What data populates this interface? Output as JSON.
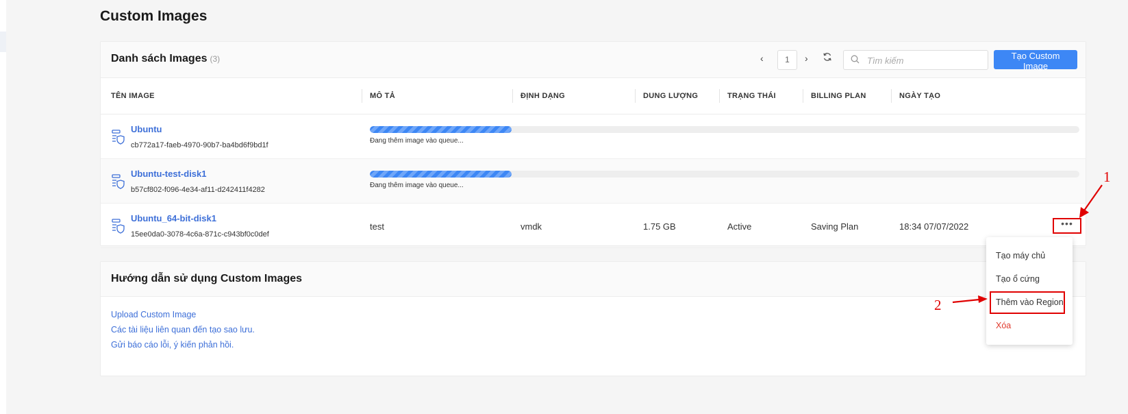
{
  "page_title": "Custom Images",
  "list_card": {
    "title": "Danh sách Images",
    "count": "(3)",
    "pagination": {
      "page": "1",
      "prev_icon": "chevron-left-icon",
      "next_icon": "chevron-right-icon"
    },
    "search": {
      "placeholder": "Tìm kiếm"
    },
    "create_button": "Tạo Custom Image"
  },
  "table": {
    "columns": [
      "TÊN IMAGE",
      "MÔ TẢ",
      "ĐỊNH DẠNG",
      "DUNG LƯỢNG",
      "TRẠNG THÁI",
      "BILLING PLAN",
      "NGÀY TẠO"
    ],
    "rows": [
      {
        "name": "Ubuntu",
        "id": "cb772a17-faeb-4970-90b7-ba4bd6f9bd1f",
        "progress_fraction": 0.2,
        "progress_text": "Đang thêm image vào queue..."
      },
      {
        "name": "Ubuntu-test-disk1",
        "id": "b57cf802-f096-4e34-af11-d242411f4282",
        "progress_fraction": 0.2,
        "progress_text": "Đang thêm image vào queue..."
      },
      {
        "name": "Ubuntu_64-bit-disk1",
        "id": "15ee0da0-3078-4c6a-871c-c943bf0c0def",
        "description": "test",
        "format": "vmdk",
        "size": "1.75 GB",
        "status": "Active",
        "billing_plan": "Saving Plan",
        "created": "18:34 07/07/2022",
        "more_label": "•••"
      }
    ]
  },
  "guide_card": {
    "title": "Hướng dẫn sử dụng Custom Images",
    "links": [
      "Upload Custom Image",
      "Các tài liệu liên quan đến tạo sao lưu.",
      "Gửi báo cáo lỗi, ý kiến phản hồi."
    ]
  },
  "dropdown_menu": {
    "items": [
      "Tạo máy chủ",
      "Tạo ổ cứng",
      "Thêm vào Region",
      "Xóa"
    ]
  },
  "annotations": {
    "marker_1": "1",
    "marker_2": "2"
  },
  "colors": {
    "primary": "#3d87f5",
    "link": "#3d6fd8",
    "danger": "#e03b2e",
    "annotation": "#e00000"
  }
}
